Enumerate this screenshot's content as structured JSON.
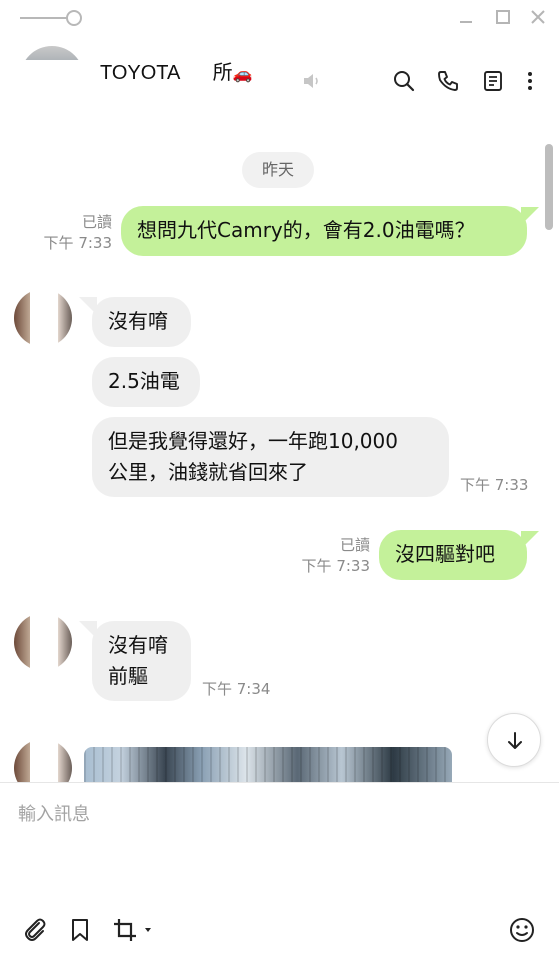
{
  "chat": {
    "title": "TOYOTA      所",
    "title_emoji": "🚗",
    "date_label": "昨天",
    "messages": [
      {
        "text": "想問九代Camry的，會有2.0油電嗎？",
        "read": "已讀",
        "time": "下午 7:33"
      },
      {
        "text": "沒有唷"
      },
      {
        "text": "2.5油電"
      },
      {
        "text": "但是我覺得還好，一年跑10,000\n公里，油錢就省回來了",
        "time": "下午 7:33"
      },
      {
        "text": "沒四驅對吧",
        "read": "已讀",
        "time": "下午 7:33"
      },
      {
        "text": "沒有唷\n前驅",
        "time": "下午 7:34"
      }
    ]
  },
  "input": {
    "placeholder": "輸入訊息"
  },
  "icons": {
    "window": [
      "pin-icon",
      "minimize-icon",
      "maximize-icon",
      "close-icon"
    ],
    "header": [
      "mute-icon",
      "search-icon",
      "phone-icon",
      "notes-icon",
      "more-icon"
    ],
    "toolbar": [
      "attach-icon",
      "bookmark-icon",
      "screenshot-icon",
      "emoji-icon"
    ],
    "scroll": "arrow-down-icon"
  },
  "colors": {
    "outgoing_bubble": "#c4f19a",
    "incoming_bubble": "#efefef",
    "meta_text": "#8a8a8a"
  }
}
